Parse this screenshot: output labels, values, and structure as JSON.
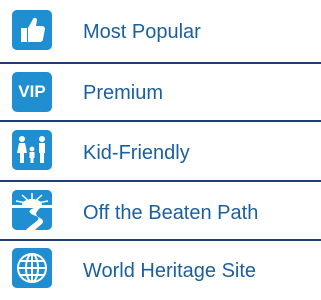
{
  "accent_color": "#1f8fd1",
  "text_color": "#1a5f9e",
  "divider_color": "#1e3f73",
  "items": [
    {
      "label": "Most Popular",
      "icon": "thumbs-up-icon"
    },
    {
      "label": "Premium",
      "icon": "vip-badge-icon",
      "icon_text": "VIP"
    },
    {
      "label": "Kid-Friendly",
      "icon": "family-icon"
    },
    {
      "label": "Off the Beaten Path",
      "icon": "winding-path-icon"
    },
    {
      "label": "World Heritage Site",
      "icon": "globe-icon"
    }
  ]
}
